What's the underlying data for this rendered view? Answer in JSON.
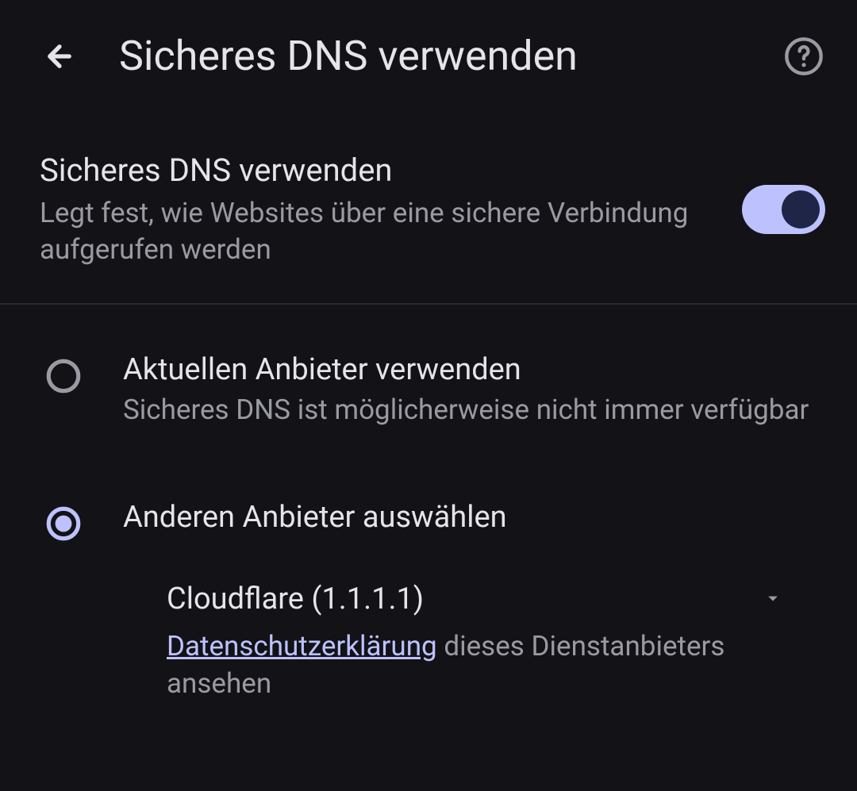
{
  "header": {
    "title": "Sicheres DNS verwenden"
  },
  "toggle_section": {
    "title": "Sicheres DNS verwenden",
    "description": "Legt fest, wie Websites über eine sichere Verbindung aufgerufen werden",
    "enabled": true
  },
  "radio_options": [
    {
      "title": "Aktuellen Anbieter verwenden",
      "description": "Sicheres DNS ist möglicherweise nicht immer verfügbar",
      "selected": false
    },
    {
      "title": "Anderen Anbieter auswählen",
      "description": "",
      "selected": true
    }
  ],
  "provider_dropdown": {
    "selected": "Cloudflare (1.1.1.1)"
  },
  "privacy": {
    "link_text": "Datenschutzerklärung",
    "suffix_text": " dieses Dienstanbieters ansehen"
  }
}
